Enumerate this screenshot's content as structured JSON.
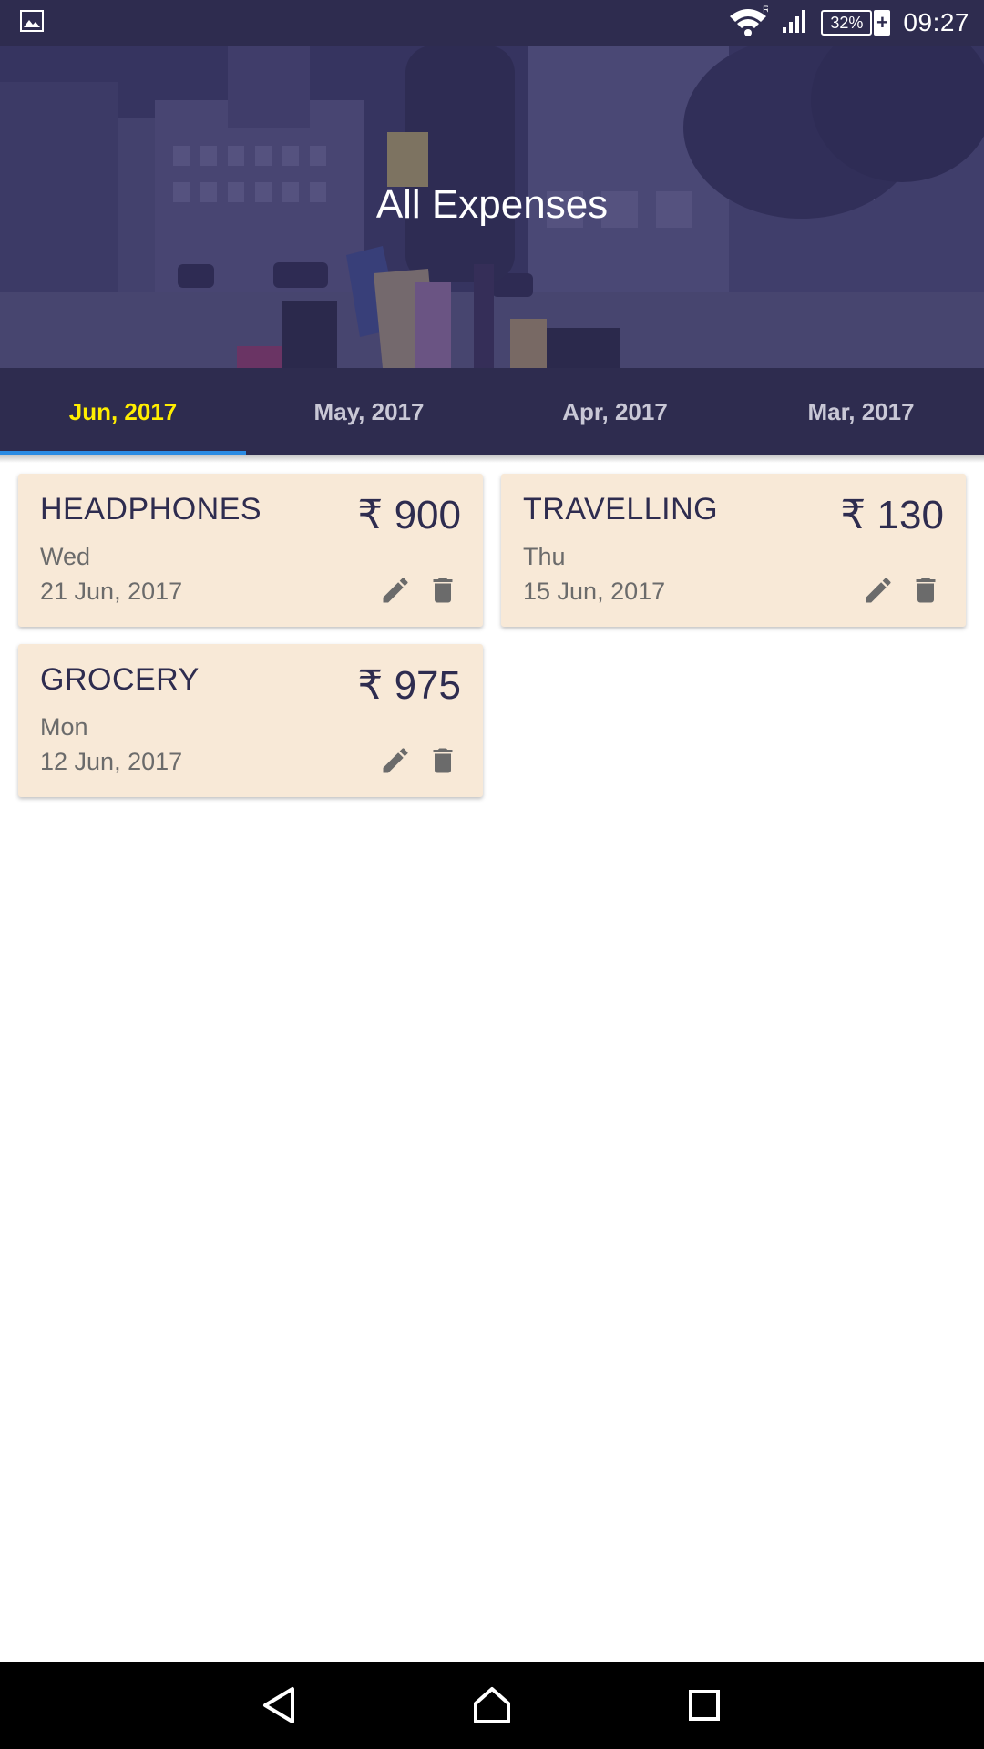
{
  "status_bar": {
    "time": "09:27",
    "battery_percent": "32%",
    "roaming_indicator": "R",
    "icons": [
      "image-icon",
      "wifi-icon",
      "signal-icon",
      "battery-icon"
    ]
  },
  "header": {
    "title": "All Expenses"
  },
  "tabs": [
    {
      "label": "Jun, 2017",
      "active": true
    },
    {
      "label": "May, 2017",
      "active": false
    },
    {
      "label": "Apr, 2017",
      "active": false
    },
    {
      "label": "Mar, 2017",
      "active": false
    }
  ],
  "expenses": [
    {
      "title": "HEADPHONES",
      "amount": "₹ 900",
      "day": "Wed",
      "date": "21 Jun, 2017"
    },
    {
      "title": "TRAVELLING",
      "amount": "₹ 130",
      "day": "Thu",
      "date": "15 Jun, 2017"
    },
    {
      "title": "GROCERY",
      "amount": "₹ 975",
      "day": "Mon",
      "date": "12 Jun, 2017"
    }
  ],
  "colors": {
    "primary": "#2e2c4f",
    "active_tab_text": "#ffee00",
    "tab_indicator": "#2b8be3",
    "card_background": "#f8e9d7"
  },
  "nav_bar": {
    "icons": [
      "back-icon",
      "home-icon",
      "recents-icon"
    ]
  }
}
